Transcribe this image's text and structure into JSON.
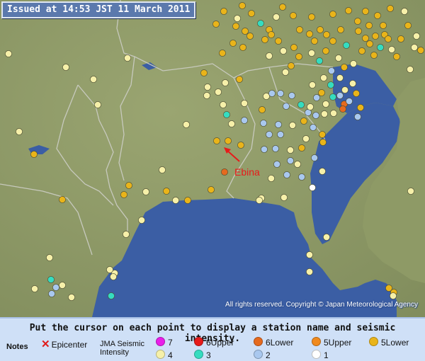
{
  "header": {
    "issued": "Issued at 14:53 JST  11 March 2011"
  },
  "annotation": {
    "ebina": "Ebina"
  },
  "map": {
    "copyright": "All rights reserved. Copyright © Japan Meteorological Agency"
  },
  "legend": {
    "instructions": "Put the cursor on each point to display a station name and seismic intensity.",
    "notes_label": "Notes",
    "epicenter_label": "Epicenter",
    "jma_label_line1": "JMA Seismic",
    "jma_label_line2": "Intensity",
    "items": [
      {
        "label": "7",
        "color": "#e91ee9"
      },
      {
        "label": "6Upper",
        "color": "#e61b1b"
      },
      {
        "label": "6Lower",
        "color": "#e56a1f"
      },
      {
        "label": "5Upper",
        "color": "#f08a1e"
      },
      {
        "label": "5Lower",
        "color": "#e9b41a"
      },
      {
        "label": "4",
        "color": "#f6f0a9"
      },
      {
        "label": "3",
        "color": "#35dcc0"
      },
      {
        "label": "2",
        "color": "#a9c8ef"
      },
      {
        "label": "1",
        "color": "#ffffff"
      }
    ]
  },
  "colors": {
    "land": "#8f9b67",
    "sea": "#3b5ea4",
    "border": "#c7c9bd",
    "legend_bg": "#cfe0f7"
  }
}
